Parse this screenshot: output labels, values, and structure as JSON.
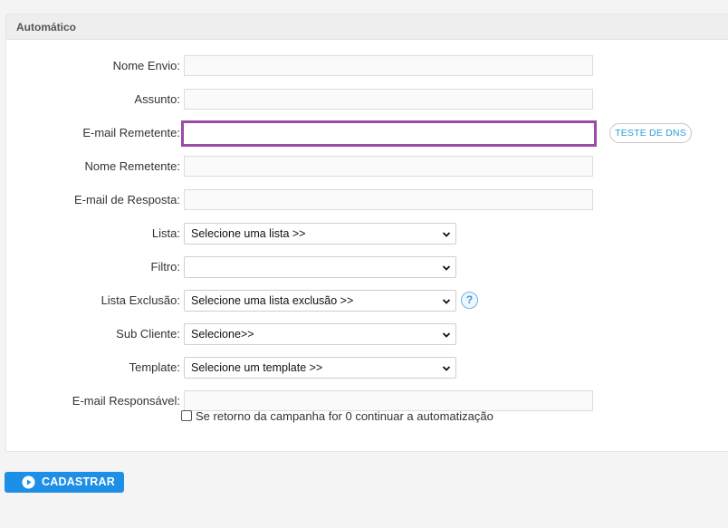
{
  "panel": {
    "title": "Automático"
  },
  "form": {
    "nome_envio": {
      "label": "Nome Envio:",
      "value": ""
    },
    "assunto": {
      "label": "Assunto:",
      "value": ""
    },
    "email_remetente": {
      "label": "E-mail Remetente:",
      "value": ""
    },
    "teste_dns_label": "TESTE DE DNS",
    "nome_remetente": {
      "label": "Nome Remetente:",
      "value": ""
    },
    "email_resposta": {
      "label": "E-mail de Resposta:",
      "value": ""
    },
    "lista": {
      "label": "Lista:",
      "selected": "Selecione uma lista >>"
    },
    "filtro": {
      "label": "Filtro:",
      "selected": ""
    },
    "lista_exclusao": {
      "label": "Lista Exclusão:",
      "selected": "Selecione uma lista exclusão >>",
      "help_glyph": "?"
    },
    "sub_cliente": {
      "label": "Sub Cliente:",
      "selected": "Selecione>>"
    },
    "template": {
      "label": "Template:",
      "selected": "Selecione um template >>"
    },
    "email_responsavel": {
      "label": "E-mail Responsável:",
      "value": ""
    },
    "continuar_checkbox": {
      "label": "Se retorno da campanha for 0 continuar a automatização",
      "checked": false
    }
  },
  "actions": {
    "submit_label": "CADASTRAR"
  },
  "colors": {
    "accent": "#1e8fe6",
    "focus_border": "#9b4aa8",
    "dns_text": "#2a9fd8"
  },
  "icons": {
    "submit": "play-circle-icon",
    "help": "question-circle-icon",
    "select": "chevron-down-icon"
  }
}
